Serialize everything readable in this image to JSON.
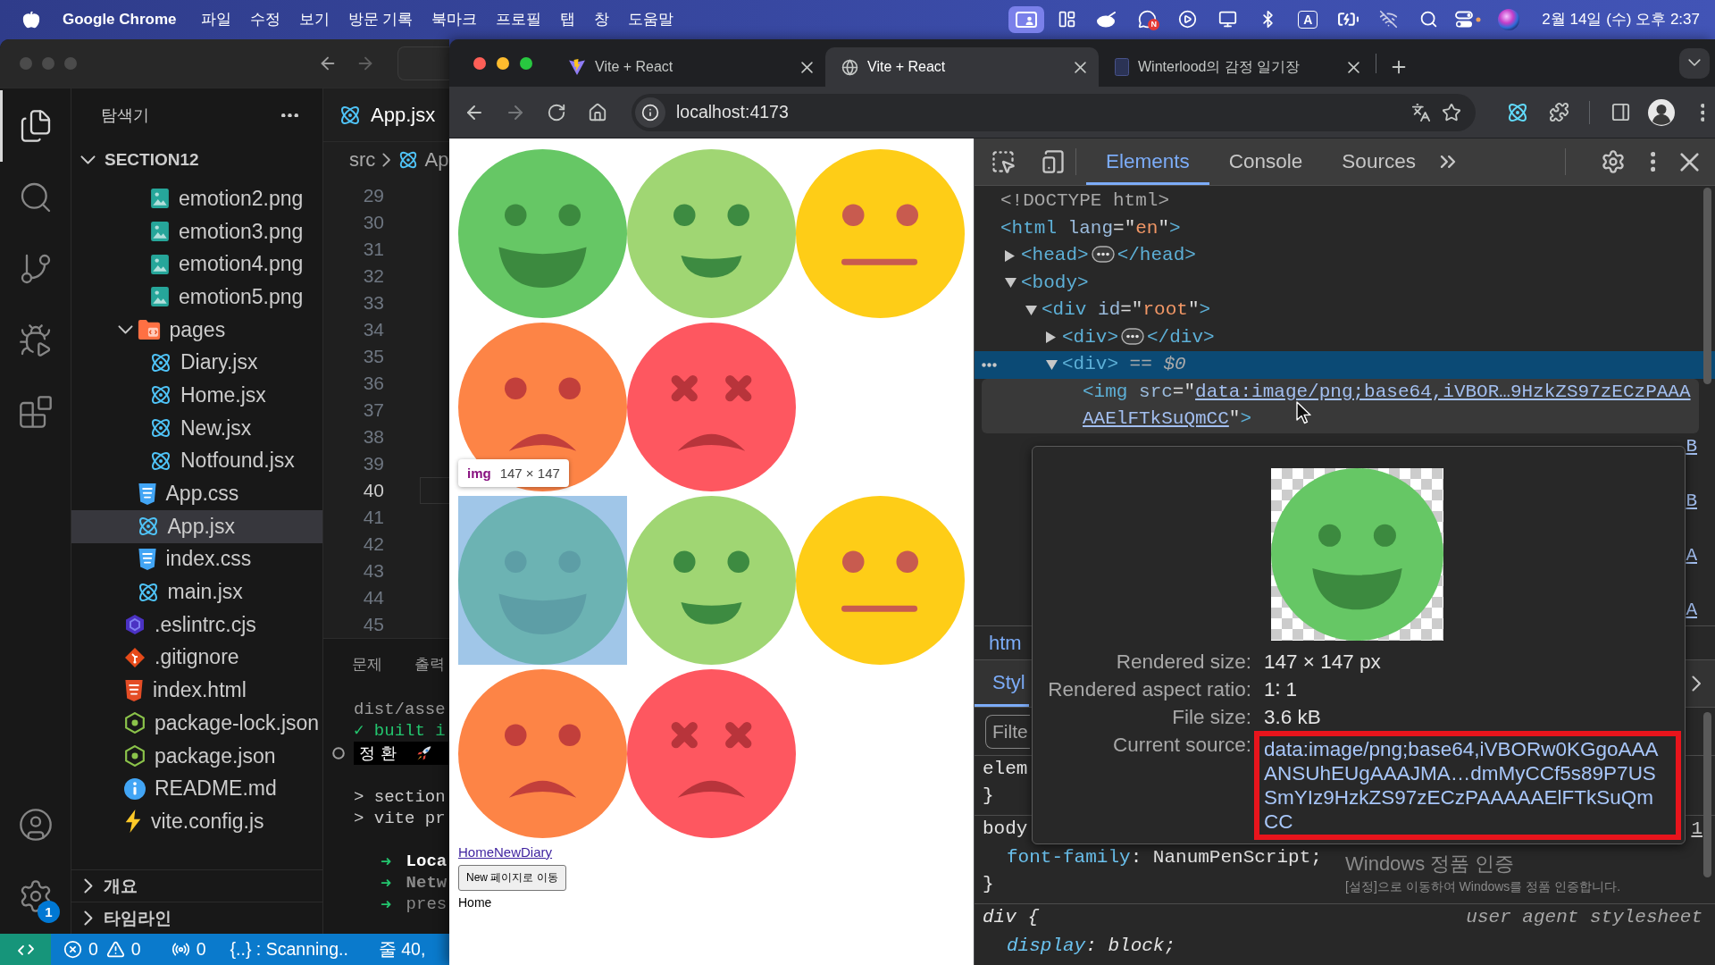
{
  "menu_bar": {
    "app": "Google Chrome",
    "menus": [
      "파일",
      "수정",
      "보기",
      "방문 기록",
      "북마크",
      "프로필",
      "탭",
      "창",
      "도움말"
    ],
    "status_items": [
      {
        "kind": "screen-share",
        "active": true
      },
      {
        "kind": "layout",
        "active": false
      },
      {
        "kind": "blob",
        "active": false
      },
      {
        "kind": "chat",
        "active": false,
        "badge": "N"
      },
      {
        "kind": "play",
        "active": false
      },
      {
        "kind": "monitor",
        "active": false
      },
      {
        "kind": "bluetooth",
        "active": false
      },
      {
        "kind": "input",
        "active": false,
        "label": "A"
      },
      {
        "kind": "battery",
        "active": false
      },
      {
        "kind": "wifi-off",
        "active": false
      },
      {
        "kind": "search",
        "active": false
      },
      {
        "kind": "control",
        "active": false
      },
      {
        "kind": "orb",
        "active": false
      }
    ],
    "clock": "2월 14일 (수) 오후 2:37"
  },
  "vscode": {
    "activity": [
      {
        "kind": "files",
        "selected": true
      },
      {
        "kind": "search",
        "selected": false
      },
      {
        "kind": "source-control",
        "selected": false
      },
      {
        "kind": "run-debug",
        "selected": false
      },
      {
        "kind": "extensions",
        "selected": false
      }
    ],
    "activity_bottom": [
      {
        "kind": "account"
      },
      {
        "kind": "settings",
        "badge": "1"
      }
    ],
    "explorer": {
      "title": "탐색기",
      "root": {
        "name": "SECTION12",
        "expanded": true,
        "children": [
          {
            "children": [
              {
                "children": [
                  {
                    "name": "emotion2.png",
                    "kind": "image",
                    "selected": false
                  },
                  {
                    "name": "emotion3.png",
                    "kind": "image",
                    "selected": false
                  },
                  {
                    "name": "emotion4.png",
                    "kind": "image",
                    "selected": false
                  },
                  {
                    "name": "emotion5.png",
                    "kind": "image",
                    "selected": false
                  }
                ]
              },
              {
                "name": "pages",
                "kind": "folder",
                "expanded": true,
                "selected": false,
                "children": [
                  {
                    "name": "Diary.jsx",
                    "kind": "react",
                    "selected": false
                  },
                  {
                    "name": "Home.jsx",
                    "kind": "react",
                    "selected": false
                  },
                  {
                    "name": "New.jsx",
                    "kind": "react",
                    "selected": false
                  },
                  {
                    "name": "Notfound.jsx",
                    "kind": "react",
                    "selected": false
                  }
                ]
              },
              {
                "name": "App.css",
                "kind": "css",
                "selected": false
              },
              {
                "name": "App.jsx",
                "kind": "react",
                "selected": true
              },
              {
                "name": "index.css",
                "kind": "css",
                "selected": false
              },
              {
                "name": "main.jsx",
                "kind": "react",
                "selected": false
              }
            ]
          },
          {
            "name": ".eslintrc.cjs",
            "kind": "eslint",
            "selected": false
          },
          {
            "name": ".gitignore",
            "kind": "git",
            "selected": false
          },
          {
            "name": "index.html",
            "kind": "html",
            "selected": false
          },
          {
            "name": "package-lock.json",
            "kind": "json",
            "selected": false
          },
          {
            "name": "package.json",
            "kind": "json",
            "selected": false
          },
          {
            "name": "README.md",
            "kind": "info",
            "selected": false
          },
          {
            "name": "vite.config.js",
            "kind": "bolt",
            "selected": false
          }
        ]
      },
      "sections": [
        {
          "title": "개요",
          "expanded": false
        },
        {
          "title": "타임라인",
          "expanded": false
        }
      ]
    },
    "editor": {
      "tab": {
        "name": "App.jsx",
        "kind": "react",
        "selected": true
      },
      "breadcrumb": [
        {
          "text": "src",
          "kind": "folder"
        },
        {
          "text": "Ap",
          "kind": "react"
        }
      ],
      "lines": [
        {
          "number": "29",
          "current": false
        },
        {
          "number": "30",
          "current": false
        },
        {
          "number": "31",
          "current": false
        },
        {
          "number": "32",
          "current": false
        },
        {
          "number": "33",
          "current": false
        },
        {
          "number": "34",
          "current": false
        },
        {
          "number": "35",
          "current": false
        },
        {
          "number": "36",
          "current": false
        },
        {
          "number": "37",
          "current": false
        },
        {
          "number": "38",
          "current": false
        },
        {
          "number": "39",
          "current": false
        },
        {
          "number": "40",
          "current": true
        },
        {
          "number": "41",
          "current": false
        },
        {
          "number": "42",
          "current": false
        },
        {
          "number": "43",
          "current": false
        },
        {
          "number": "44",
          "current": false
        },
        {
          "number": "45",
          "current": false
        }
      ]
    },
    "panel": {
      "tabs": [
        {
          "label": "문제",
          "selected": false
        },
        {
          "label": "출력",
          "selected": false
        }
      ],
      "blocks": [
        [
          {
            "kind": "dim",
            "text": "dist/asse"
          },
          {
            "kind": "success",
            "text": "✓ built i"
          },
          {
            "kind": "badge",
            "text": "정 환"
          }
        ],
        [
          {
            "kind": "plain",
            "text": "> section"
          },
          {
            "kind": "plain",
            "text": "> vite pr"
          }
        ],
        [
          {
            "kind": "server-bold",
            "arrow": "➜",
            "text": "Loca"
          },
          {
            "kind": "server-dim-bold",
            "arrow": "➜",
            "text": "Netw"
          },
          {
            "kind": "server-dim",
            "arrow": "➜",
            "text": "pres"
          }
        ]
      ]
    },
    "status_bar": {
      "errors": "0",
      "warnings": "0",
      "ports": "0",
      "scanning": "{..} : Scanning..",
      "position": "줄 40,"
    }
  },
  "browser": {
    "tabs": [
      {
        "title": "Vite + React",
        "kind": "bolt",
        "selected": false
      },
      {
        "title": "Vite + React",
        "kind": "globe",
        "selected": true
      },
      {
        "title": "Winterlood의 감정 일기장",
        "kind": "page",
        "selected": false
      }
    ],
    "address": "localhost:4173",
    "page": {
      "groups": [
        [
          {
            "kind": "grin",
            "inspected": false
          },
          {
            "kind": "smile",
            "inspected": false
          },
          {
            "kind": "neutral",
            "inspected": false
          },
          {
            "kind": "frown",
            "inspected": false
          },
          {
            "kind": "distress",
            "inspected": false
          }
        ],
        [
          {
            "kind": "grin",
            "inspected": true
          },
          {
            "kind": "smile",
            "inspected": false
          },
          {
            "kind": "neutral",
            "inspected": false
          },
          {
            "kind": "frown",
            "inspected": false
          },
          {
            "kind": "distress",
            "inspected": false
          }
        ]
      ],
      "tooltip": {
        "tag": "img",
        "size": "147 × 147"
      },
      "links": [
        "Home",
        "New",
        "Diary"
      ],
      "button": "New 페이지로 이동",
      "label": "Home"
    }
  },
  "devtools": {
    "tabs": [
      {
        "label": "Elements",
        "selected": true
      },
      {
        "label": "Console",
        "selected": false
      },
      {
        "label": "Sources",
        "selected": false
      }
    ],
    "dom": [
      {
        "tokens": [
          {
            "kind": "doctype",
            "text": "<!DOCTYPE html>"
          }
        ],
        "selected": false,
        "hovered": false
      },
      {
        "tokens": [
          {
            "kind": "tag",
            "text": "<html"
          },
          {
            "kind": "attr",
            "text": " lang"
          },
          {
            "kind": "punct",
            "text": "=\""
          },
          {
            "kind": "value",
            "text": "en"
          },
          {
            "kind": "punct",
            "text": "\""
          },
          {
            "kind": "tag",
            "text": ">"
          }
        ],
        "selected": false,
        "hovered": false,
        "children": [
          {
            "tokens": [
              {
                "kind": "tag",
                "text": "<head>"
              },
              {
                "kind": "collapsed"
              },
              {
                "kind": "tag",
                "text": "</head>"
              }
            ],
            "expanded": false,
            "selected": false,
            "hovered": false
          },
          {
            "tokens": [
              {
                "kind": "tag",
                "text": "<body>"
              }
            ],
            "expanded": true,
            "selected": false,
            "hovered": false,
            "children": [
              {
                "tokens": [
                  {
                    "kind": "tag",
                    "text": "<div"
                  },
                  {
                    "kind": "attr",
                    "text": " id"
                  },
                  {
                    "kind": "punct",
                    "text": "=\""
                  },
                  {
                    "kind": "value",
                    "text": "root"
                  },
                  {
                    "kind": "punct",
                    "text": "\""
                  },
                  {
                    "kind": "tag",
                    "text": ">"
                  }
                ],
                "expanded": true,
                "selected": false,
                "hovered": false,
                "children": [
                  {
                    "tokens": [
                      {
                        "kind": "tag",
                        "text": "<div>"
                      },
                      {
                        "kind": "collapsed"
                      },
                      {
                        "kind": "tag",
                        "text": "</div>"
                      }
                    ],
                    "expanded": false,
                    "selected": false,
                    "hovered": false
                  },
                  {
                    "tokens": [
                      {
                        "kind": "tag",
                        "text": "<div>"
                      },
                      {
                        "kind": "marker",
                        "text": " == $0"
                      }
                    ],
                    "expanded": true,
                    "selected": true,
                    "hovered": false,
                    "children": [
                      {
                        "tokens": [
                          {
                            "kind": "tag",
                            "text": "<img"
                          },
                          {
                            "kind": "attr",
                            "text": " src"
                          },
                          {
                            "kind": "punct",
                            "text": "=\""
                          },
                          {
                            "kind": "link",
                            "text": "data:image/png;base64,iVBOR…9HzkZS97zECzPAAA"
                          },
                          {
                            "kind": "link",
                            "text": "AAElFTkSuQmCC"
                          },
                          {
                            "kind": "punct",
                            "text": "\""
                          },
                          {
                            "kind": "tag",
                            "text": ">"
                          }
                        ],
                        "selected": false,
                        "hovered": true
                      }
                    ]
                  }
                ]
              }
            ]
          }
        ]
      }
    ],
    "dom_peek": [
      "B",
      "B",
      "A",
      "A"
    ],
    "breadcrumb": "htm",
    "styles_tab": {
      "label": "Styl",
      "selected": true
    },
    "filter": {
      "placeholder": "Filte"
    },
    "rules": [
      {
        "kind": "author",
        "selector": "elem",
        "closing": "}"
      },
      {
        "kind": "author",
        "selector": "body",
        "source": "1",
        "declarations": [
          {
            "property": "font-family",
            "colon": ":",
            "value": "NanumPenScript;"
          }
        ],
        "closing": "}"
      },
      {
        "kind": "user-agent",
        "selector": "div {",
        "origin": "user agent stylesheet",
        "declarations": [
          {
            "property": "display",
            "colon": ":",
            "value": "block;"
          }
        ]
      }
    ],
    "preview": {
      "kind": "grin",
      "rows": [
        {
          "label": "Rendered size:",
          "value": "147 × 147 px",
          "kind": "text",
          "boxed": false
        },
        {
          "label": "Rendered aspect ratio:",
          "value": "1∶ 1",
          "kind": "text",
          "boxed": false
        },
        {
          "label": "File size:",
          "value": "3.6 kB",
          "kind": "text",
          "boxed": false
        },
        {
          "label": "Current source:",
          "value": "data:image/png;base64,iVBORw0KGgoAAAANSUhEUgAAAJMA…dmMyCCf5s89P7USSmYIz9HzkZS97zECzPAAAAAElFTkSuQmCC",
          "kind": "link",
          "boxed": true
        }
      ]
    },
    "activation_notice": {
      "title": "Windows 정품 인증",
      "message": "[설정]으로 이동하여 Windows를 정품 인증합니다."
    }
  }
}
